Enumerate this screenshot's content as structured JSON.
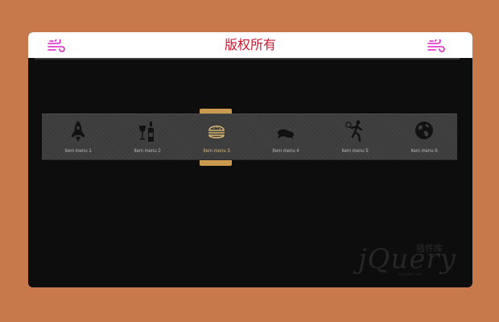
{
  "header": {
    "title": "版权所有",
    "left_icon": "wind-icon",
    "right_icon": "wind-icon",
    "accent_color": "#d0142c",
    "icon_color": "#e020c8"
  },
  "menu": {
    "active_index": 2,
    "active_color": "#c99a50",
    "items": [
      {
        "label": "Item menu 1",
        "icon": "rocket-icon"
      },
      {
        "label": "Item menu 2",
        "icon": "wine-icon"
      },
      {
        "label": "Item menu 3",
        "icon": "burger-icon"
      },
      {
        "label": "Item menu 4",
        "icon": "chat-icon"
      },
      {
        "label": "Item menu 5",
        "icon": "tennis-icon"
      },
      {
        "label": "Item menu 6",
        "icon": "globe-icon"
      }
    ]
  },
  "watermark": {
    "text": "jQuery",
    "subtitle": "插件库",
    "url": "www.jq22.com"
  }
}
